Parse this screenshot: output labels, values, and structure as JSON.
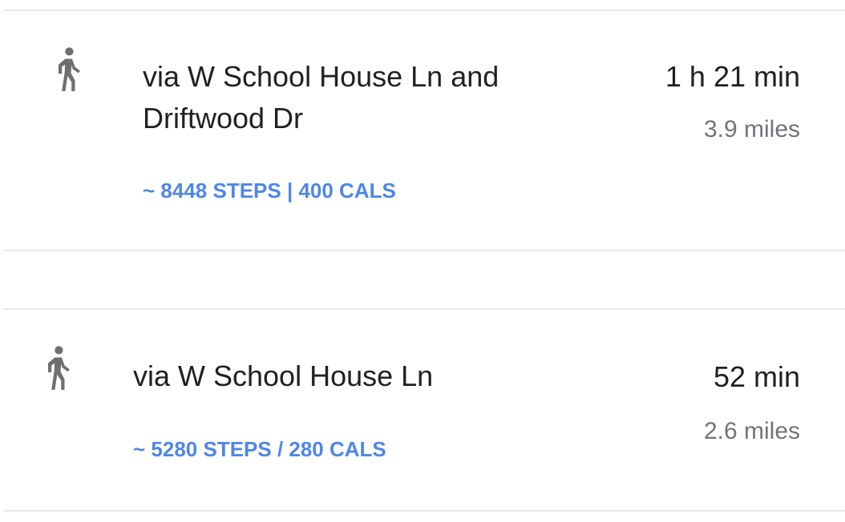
{
  "icons": {
    "walk": "person-walking-icon",
    "color": "#6f6f6f"
  },
  "colors": {
    "stats": "#4f86e8",
    "primary_text": "#202124",
    "secondary_text": "#70757a",
    "divider": "#e8e8e8"
  },
  "routes": [
    {
      "name_line1": "via W School House Ln and",
      "name_line2": "Driftwood Dr",
      "time": "1 h 21 min",
      "distance": "3.9 miles",
      "stats": "~ 8448 STEPS | 400 CALS"
    },
    {
      "name_line1": "via W School House Ln",
      "time": "52 min",
      "distance": "2.6 miles",
      "stats": "~ 5280 STEPS / 280 CALS"
    }
  ]
}
